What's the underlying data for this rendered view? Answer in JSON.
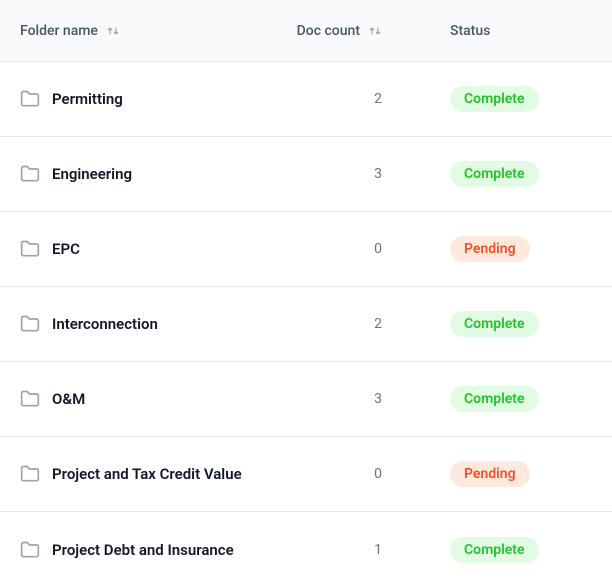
{
  "headers": {
    "name": "Folder name",
    "count": "Doc count",
    "status": "Status"
  },
  "rows": [
    {
      "name": "Permitting",
      "count": "2",
      "status": "Complete",
      "statusType": "complete"
    },
    {
      "name": "Engineering",
      "count": "3",
      "status": "Complete",
      "statusType": "complete"
    },
    {
      "name": "EPC",
      "count": "0",
      "status": "Pending",
      "statusType": "pending"
    },
    {
      "name": "Interconnection",
      "count": "2",
      "status": "Complete",
      "statusType": "complete"
    },
    {
      "name": "O&M",
      "count": "3",
      "status": "Complete",
      "statusType": "complete"
    },
    {
      "name": "Project and Tax Credit Value",
      "count": "0",
      "status": "Pending",
      "statusType": "pending"
    },
    {
      "name": "Project Debt and Insurance",
      "count": "1",
      "status": "Complete",
      "statusType": "complete"
    }
  ]
}
